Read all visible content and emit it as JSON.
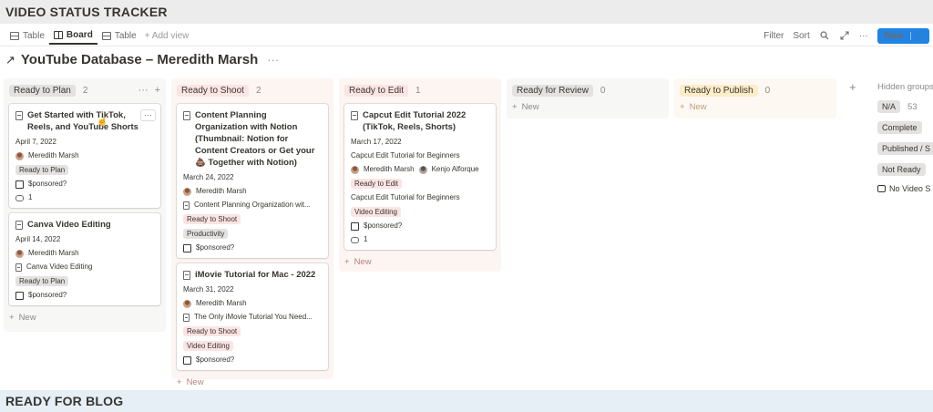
{
  "sections": {
    "top_title": "VIDEO STATUS TRACKER",
    "bottom_title": "READY FOR BLOG"
  },
  "viewbar": {
    "tabs": [
      {
        "label": "Table"
      },
      {
        "label": "Board"
      },
      {
        "label": "Table"
      }
    ],
    "add_view": "+ Add view",
    "filter": "Filter",
    "sort": "Sort",
    "more": "···",
    "new_label": "New"
  },
  "database": {
    "arrow": "↗",
    "title": "YouTube Database – Meredith Marsh",
    "menu": "···"
  },
  "columns": [
    {
      "label": "Ready to Plan",
      "count": "2",
      "color": "#e3e2e0",
      "bg": "#f7f7f5",
      "cards": [
        {
          "title": "Get Started with TikTok, Reels, and YouTube Shorts",
          "date": "April 7, 2022",
          "person": "Meredith Marsh",
          "tag": "Ready to Plan",
          "sponsored": "$ponsored?",
          "comments": "1"
        },
        {
          "title": "Canva Video Editing",
          "date": "April 14, 2022",
          "person": "Meredith Marsh",
          "page": "Canva Video Editing",
          "tag": "Ready to Plan",
          "sponsored": "$ponsored?"
        }
      ],
      "new_label": "New"
    },
    {
      "label": "Ready to Shoot",
      "count": "2",
      "color": "#fbe4e4",
      "bg": "#fdf5f2",
      "cards": [
        {
          "title": "Content Planning Organization with Notion (Thumbnail: Notion for Content Creators or Get your 💩 Together with Notion)",
          "date": "March 24, 2022",
          "person": "Meredith Marsh",
          "page": "Content Planning Organization wit...",
          "tag": "Ready to Shoot",
          "tag2": "Productivity",
          "sponsored": "$ponsored?"
        },
        {
          "title": "iMovie Tutorial for Mac - 2022",
          "date": "March 31, 2022",
          "person": "Meredith Marsh",
          "page": "The Only iMovie Tutorial You Need...",
          "tag": "Ready to Shoot",
          "tag2": "Video Editing",
          "sponsored": "$ponsored?"
        }
      ],
      "new_label": "New"
    },
    {
      "label": "Ready to Edit",
      "count": "1",
      "color": "#fbe4e4",
      "bg": "#fdf5f2",
      "cards": [
        {
          "title": "Capcut Edit Tutorial 2022 (TikTok, Reels, Shorts)",
          "date": "March 17, 2022",
          "subtitle": "Capcut Edit Tutorial for Beginners",
          "person": "Meredith Marsh",
          "person2": "Kenjo Alforque",
          "tag": "Ready to Edit",
          "note": "Capcut Edit Tutorial for Beginners",
          "tag2": "Video Editing",
          "sponsored": "$ponsored?",
          "comments": "1"
        }
      ],
      "new_label": "New"
    },
    {
      "label": "Ready for Review",
      "count": "0",
      "color": "#e3e2e0",
      "bg": "#f7f7f5",
      "cards": [],
      "new_label": "New"
    },
    {
      "label": "Ready to Publish",
      "count": "0",
      "color": "#fdecc8",
      "bg": "#fdf8f1",
      "cards": [],
      "new_label": "New"
    }
  ],
  "hidden": {
    "title": "Hidden groups",
    "items": [
      {
        "label": "N/A",
        "count": "53"
      },
      {
        "label": "Complete"
      },
      {
        "label": "Published / S"
      },
      {
        "label": "Not Ready"
      },
      {
        "label": "No Video S"
      }
    ]
  }
}
